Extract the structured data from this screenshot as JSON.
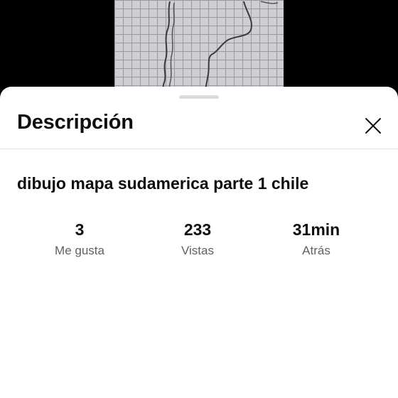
{
  "sheet": {
    "title": "Descripción",
    "video_title": "dibujo mapa sudamerica parte 1 chile",
    "close_icon": "close-icon"
  },
  "stats": [
    {
      "value": "3",
      "label": "Me gusta"
    },
    {
      "value": "233",
      "label": "Vistas"
    },
    {
      "value": "31min",
      "label": "Atrás"
    }
  ],
  "colors": {
    "sheet_background": "#ffffff",
    "primary_text": "#0f0f0f",
    "secondary_text": "#606060",
    "background": "#000000"
  }
}
